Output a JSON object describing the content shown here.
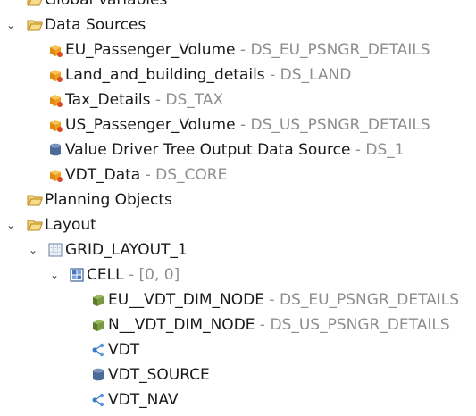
{
  "tree": {
    "global_variables": {
      "label": "Global Variables"
    },
    "data_sources": {
      "label": "Data Sources",
      "children": [
        {
          "name": "EU_Passenger_Volume",
          "ref": " - DS_EU_PSNGR_DETAILS",
          "icon": "cube-datasource-icon"
        },
        {
          "name": "Land_and_building_details",
          "ref": " - DS_LAND",
          "icon": "cube-datasource-icon"
        },
        {
          "name": "Tax_Details",
          "ref": " - DS_TAX",
          "icon": "cube-datasource-icon"
        },
        {
          "name": "US_Passenger_Volume",
          "ref": " - DS_US_PSNGR_DETAILS",
          "icon": "cube-datasource-icon"
        },
        {
          "name": "Value Driver Tree Output Data Source",
          "ref": " - DS_1",
          "icon": "database-icon"
        },
        {
          "name": "VDT_Data",
          "ref": " - DS_CORE",
          "icon": "cube-datasource-icon"
        }
      ]
    },
    "planning_objects": {
      "label": "Planning Objects"
    },
    "layout": {
      "label": "Layout",
      "grid": {
        "label": "GRID_LAYOUT_1",
        "cell": {
          "label": "CELL",
          "ref": " - [0, 0]",
          "children": [
            {
              "name": "EU__VDT_DIM_NODE",
              "ref": " - DS_EU_PSNGR_DETAILS",
              "icon": "dimension-node-icon"
            },
            {
              "name": "N__VDT_DIM_NODE",
              "ref": " - DS_US_PSNGR_DETAILS",
              "icon": "dimension-node-icon"
            },
            {
              "name": "VDT",
              "ref": "",
              "icon": "value-driver-tree-icon"
            },
            {
              "name": "VDT_SOURCE",
              "ref": "",
              "icon": "database-icon"
            },
            {
              "name": "VDT_NAV",
              "ref": "",
              "icon": "value-driver-tree-icon"
            }
          ]
        }
      }
    }
  },
  "colors": {
    "secondary_text": "#8e8e8e",
    "folder": "#e8b84a",
    "cube": "#f0a020",
    "dim_node": "#6b8e3a",
    "db": "#4a6a9a",
    "vdt": "#3a7ac8"
  }
}
